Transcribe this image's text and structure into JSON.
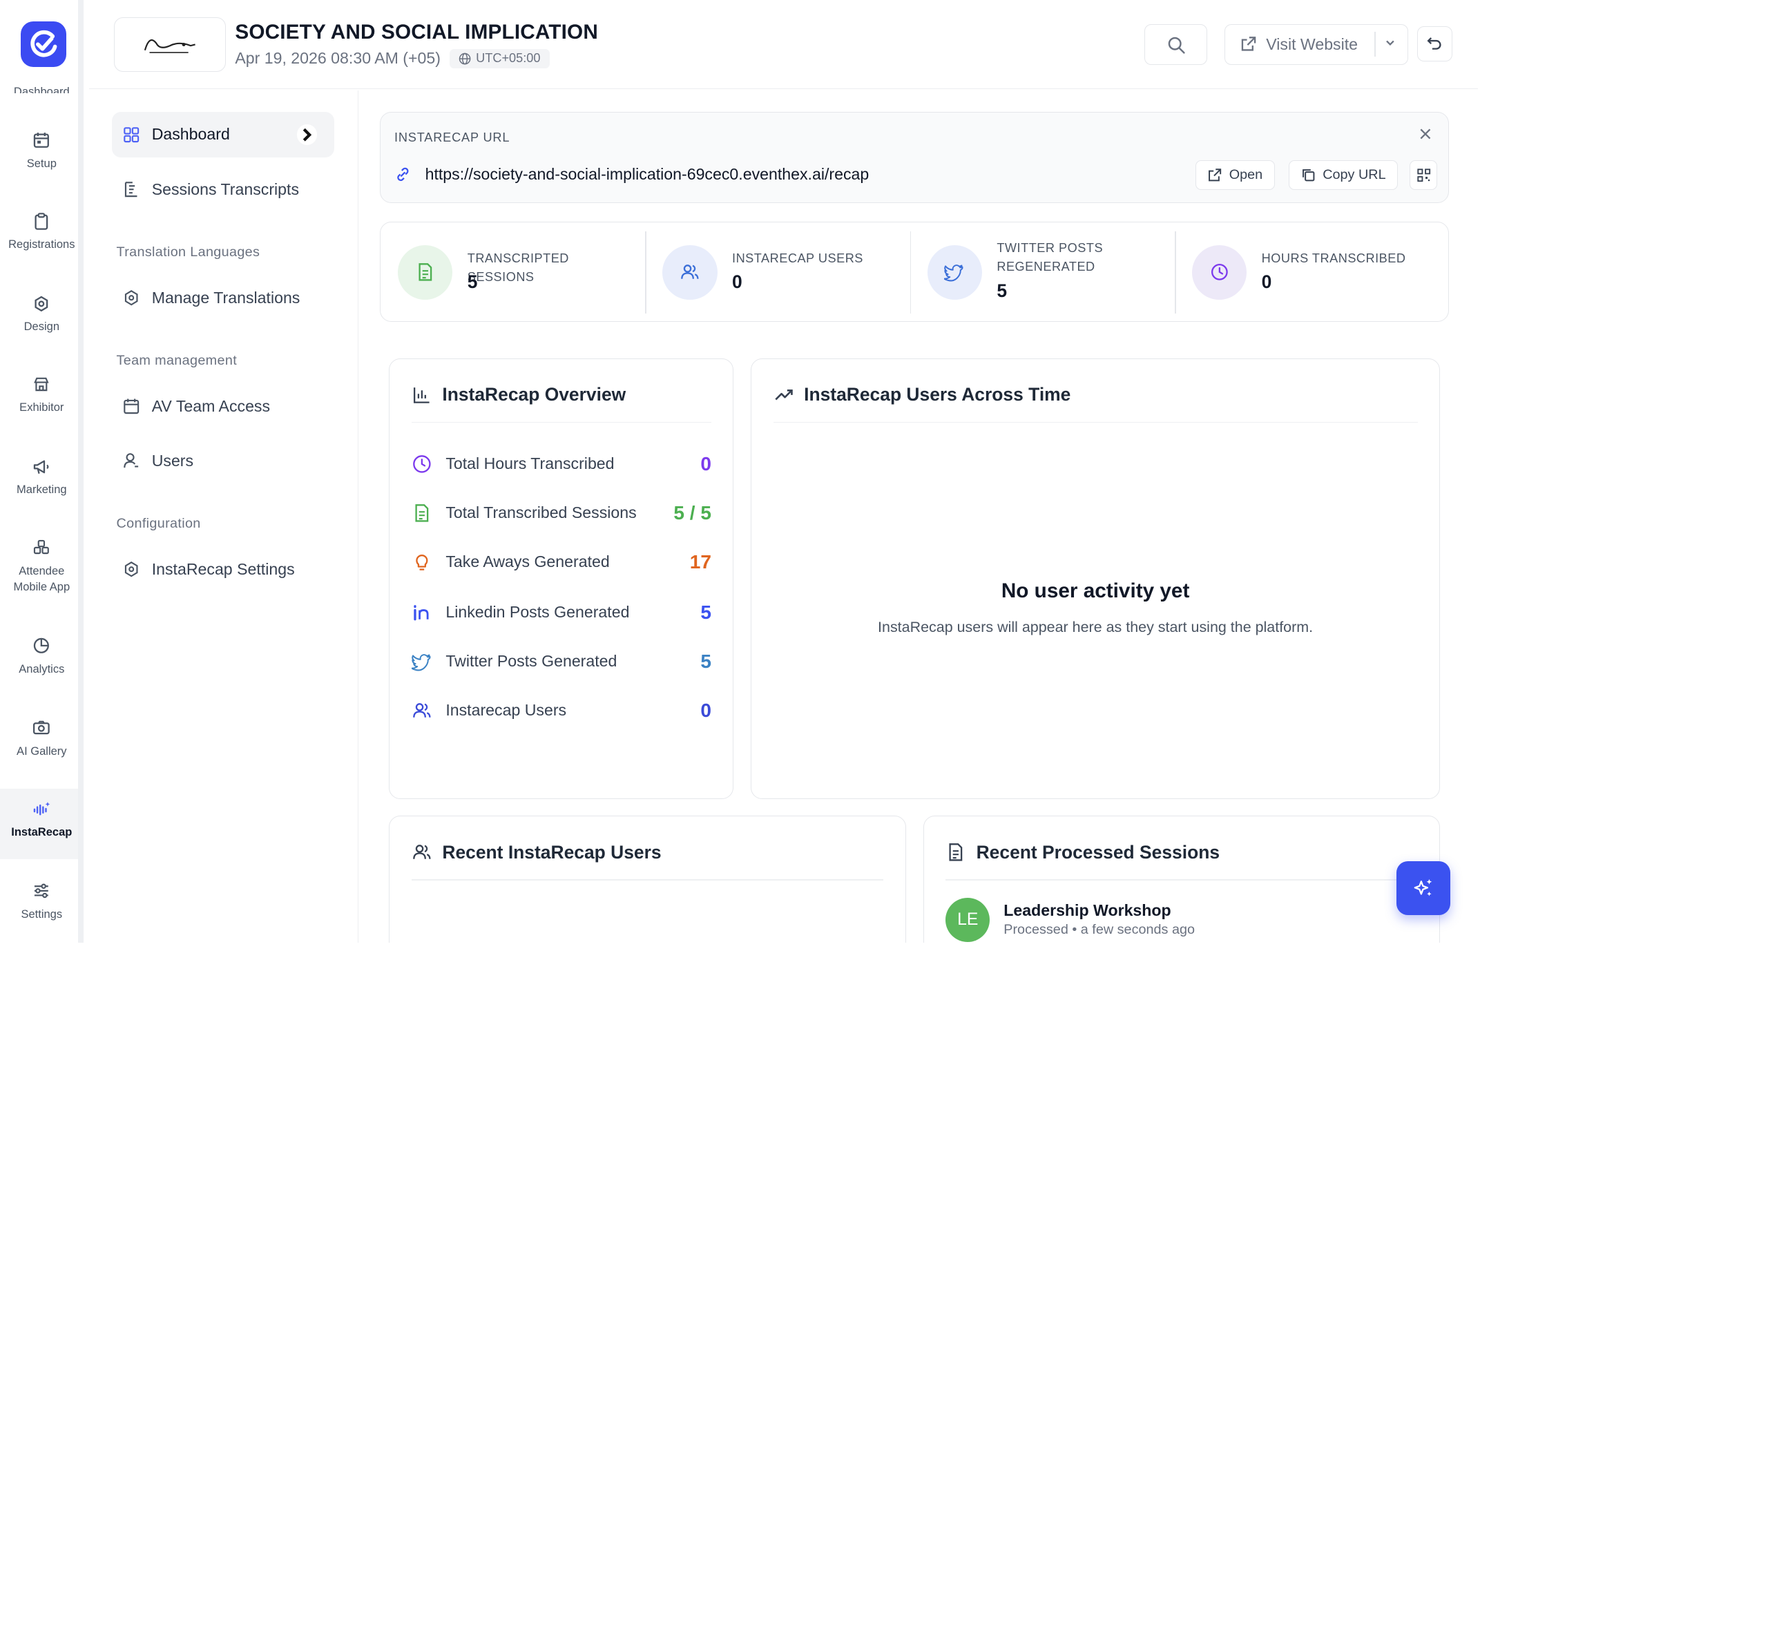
{
  "colors": {
    "brand": "#3b4bf2",
    "green": "#4caf50",
    "purple": "#7c3aed",
    "orange": "#e0651f",
    "blue": "#3b6fd8"
  },
  "rail": {
    "partial_label": "Dashboard",
    "items": [
      {
        "label": "Setup",
        "icon": "calendar-icon"
      },
      {
        "label": "Registrations",
        "icon": "clipboard-icon"
      },
      {
        "label": "Design",
        "icon": "palette-icon"
      },
      {
        "label": "Exhibitor",
        "icon": "store-icon"
      },
      {
        "label": "Marketing",
        "icon": "megaphone-icon"
      },
      {
        "label": "Attendee Mobile App",
        "icon": "mobile-app-icon"
      },
      {
        "label": "Analytics",
        "icon": "pie-chart-icon"
      },
      {
        "label": "AI Gallery",
        "icon": "camera-icon"
      },
      {
        "label": "InstaRecap",
        "icon": "instarecap-icon"
      },
      {
        "label": "Settings",
        "icon": "sliders-icon"
      }
    ]
  },
  "header": {
    "title": "SOCIETY AND SOCIAL IMPLICATION",
    "date": "Apr 19, 2026 08:30 AM (+05)",
    "timezone": "UTC+05:00",
    "visit_label": "Visit Website"
  },
  "subnav": {
    "dashboard": "Dashboard",
    "sessions_transcripts": "Sessions Transcripts",
    "group_translation": "Translation Languages",
    "manage_translations": "Manage Translations",
    "group_team": "Team management",
    "av_team_access": "AV Team Access",
    "users": "Users",
    "group_config": "Configuration",
    "instarecap_settings": "InstaRecap Settings"
  },
  "url_card": {
    "label": "INSTARECAP URL",
    "url": "https://society-and-social-implication-69cec0.eventhex.ai/recap",
    "open_label": "Open",
    "copy_label": "Copy URL"
  },
  "stats": [
    {
      "label": "TRANSCRIPTED SESSIONS",
      "value": "5"
    },
    {
      "label": "INSTARECAP USERS",
      "value": "0"
    },
    {
      "label": "TWITTER POSTS REGENERATED",
      "value": "5"
    },
    {
      "label": "HOURS TRANSCRIBED",
      "value": "0"
    }
  ],
  "overview": {
    "title": "InstaRecap Overview",
    "rows": [
      {
        "label": "Total Hours Transcribed",
        "value": "0"
      },
      {
        "label": "Total Transcribed Sessions",
        "value": "5 / 5"
      },
      {
        "label": "Take Aways Generated",
        "value": "17"
      },
      {
        "label": "Linkedin Posts Generated",
        "value": "5"
      },
      {
        "label": "Twitter Posts Generated",
        "value": "5"
      },
      {
        "label": "Instarecap Users",
        "value": "0"
      }
    ]
  },
  "users_time": {
    "title": "InstaRecap Users Across Time",
    "empty_title": "No user activity yet",
    "empty_sub": "InstaRecap users will appear here as they start using the platform."
  },
  "recent_users": {
    "title": "Recent InstaRecap Users"
  },
  "recent_sessions": {
    "title": "Recent Processed Sessions",
    "items": [
      {
        "initials": "LE",
        "name": "Leadership Workshop",
        "meta": "Processed • a few seconds ago"
      }
    ]
  }
}
